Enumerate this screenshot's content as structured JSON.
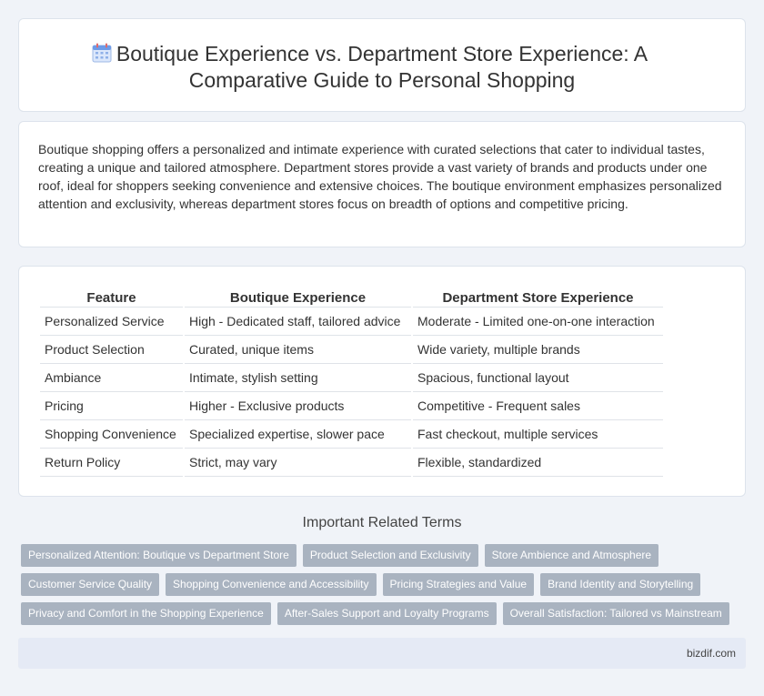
{
  "header": {
    "title": "Boutique Experience vs. Department Store Experience: A Comparative Guide to Personal Shopping",
    "icon": "calendar-icon"
  },
  "intro": {
    "text": "Boutique shopping offers a personalized and intimate experience with curated selections that cater to individual tastes, creating a unique and tailored atmosphere. Department stores provide a vast variety of brands and products under one roof, ideal for shoppers seeking convenience and extensive choices. The boutique environment emphasizes personalized attention and exclusivity, whereas department stores focus on breadth of options and competitive pricing."
  },
  "table": {
    "headers": [
      "Feature",
      "Boutique Experience",
      "Department Store Experience"
    ],
    "rows": [
      [
        "Personalized Service",
        "High - Dedicated staff, tailored advice",
        "Moderate - Limited one-on-one interaction"
      ],
      [
        "Product Selection",
        "Curated, unique items",
        "Wide variety, multiple brands"
      ],
      [
        "Ambiance",
        "Intimate, stylish setting",
        "Spacious, functional layout"
      ],
      [
        "Pricing",
        "Higher - Exclusive products",
        "Competitive - Frequent sales"
      ],
      [
        "Shopping Convenience",
        "Specialized expertise, slower pace",
        "Fast checkout, multiple services"
      ],
      [
        "Return Policy",
        "Strict, may vary",
        "Flexible, standardized"
      ]
    ]
  },
  "related": {
    "title": "Important Related Terms",
    "tags": [
      "Personalized Attention: Boutique vs Department Store",
      "Product Selection and Exclusivity",
      "Store Ambience and Atmosphere",
      "Customer Service Quality",
      "Shopping Convenience and Accessibility",
      "Pricing Strategies and Value",
      "Brand Identity and Storytelling",
      "Privacy and Comfort in the Shopping Experience",
      "After-Sales Support and Loyalty Programs",
      "Overall Satisfaction: Tailored vs Mainstream"
    ]
  },
  "footer": {
    "site": "bizdif.com"
  },
  "colors": {
    "background": "#f0f3f8",
    "tag": "#a9b3c0",
    "footer": "#e5eaf5"
  }
}
